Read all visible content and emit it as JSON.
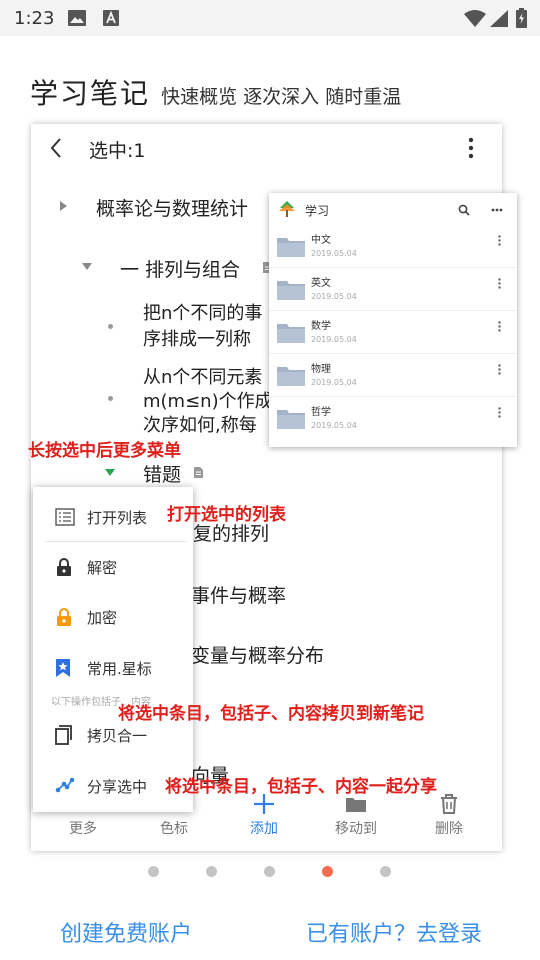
{
  "status_bar": {
    "time": "1:23"
  },
  "headline": {
    "main": "学习笔记",
    "sub": "快速概览 逐次深入 随时重温"
  },
  "app_bar": {
    "title": "选中:1"
  },
  "tree": {
    "item1": "概率论与数理统计",
    "item2": "一 排列与组合",
    "item3_line1": "把n个不同的事",
    "item3_line2": "序排成一列称",
    "item4_line1": "从n个不同元素",
    "item4_line2": "m(m≤n)个作成",
    "item4_line3": "次序如何,称每",
    "item5": "错题",
    "item6": "复的排列",
    "item7": "事件与概率",
    "item8": "变量与概率分布",
    "item9": "向量"
  },
  "toolbar": {
    "more": "更多",
    "color": "色标",
    "add": "添加",
    "move": "移动到",
    "delete": "删除"
  },
  "folder_popup": {
    "title": "学习",
    "folders": [
      {
        "name": "中文",
        "date": "2019.05.04"
      },
      {
        "name": "英文",
        "date": "2019.05.04"
      },
      {
        "name": "数学",
        "date": "2019.05.04"
      },
      {
        "name": "物理",
        "date": "2019.05.04"
      },
      {
        "name": "哲学",
        "date": "2019.05.04"
      }
    ]
  },
  "context_menu": {
    "open_list": "打开列表",
    "decrypt": "解密",
    "encrypt": "加密",
    "star": "常用.星标",
    "section_note": "以下操作包括子、内容",
    "merge_copy": "拷贝合一",
    "share": "分享选中"
  },
  "annotations": {
    "long_press": "长按选中后更多菜单",
    "open_selected": "打开选中的列表",
    "copy_note": "将选中条目，包括子、内容拷贝到新笔记",
    "share_note": "将选中条目，包括子、内容一起分享"
  },
  "pager": {
    "count": 5,
    "active_index": 3
  },
  "links": {
    "create_account": "创建免费账户",
    "login": "已有账户？去登录"
  },
  "colors": {
    "accent_blue": "#2f7fe6",
    "link_blue": "#3a8fe8",
    "annotation_red": "#e0201c",
    "pager_active": "#f36c4f",
    "lock_gray": "#333333",
    "lock_orange": "#f59a12",
    "star_blue": "#2f6fe0",
    "expand_green": "#2aa44a"
  },
  "icons": {
    "status": [
      "image-icon",
      "a-icon",
      "wifi-icon",
      "signal-icon",
      "battery-icon"
    ],
    "folder": "folder-icon"
  }
}
